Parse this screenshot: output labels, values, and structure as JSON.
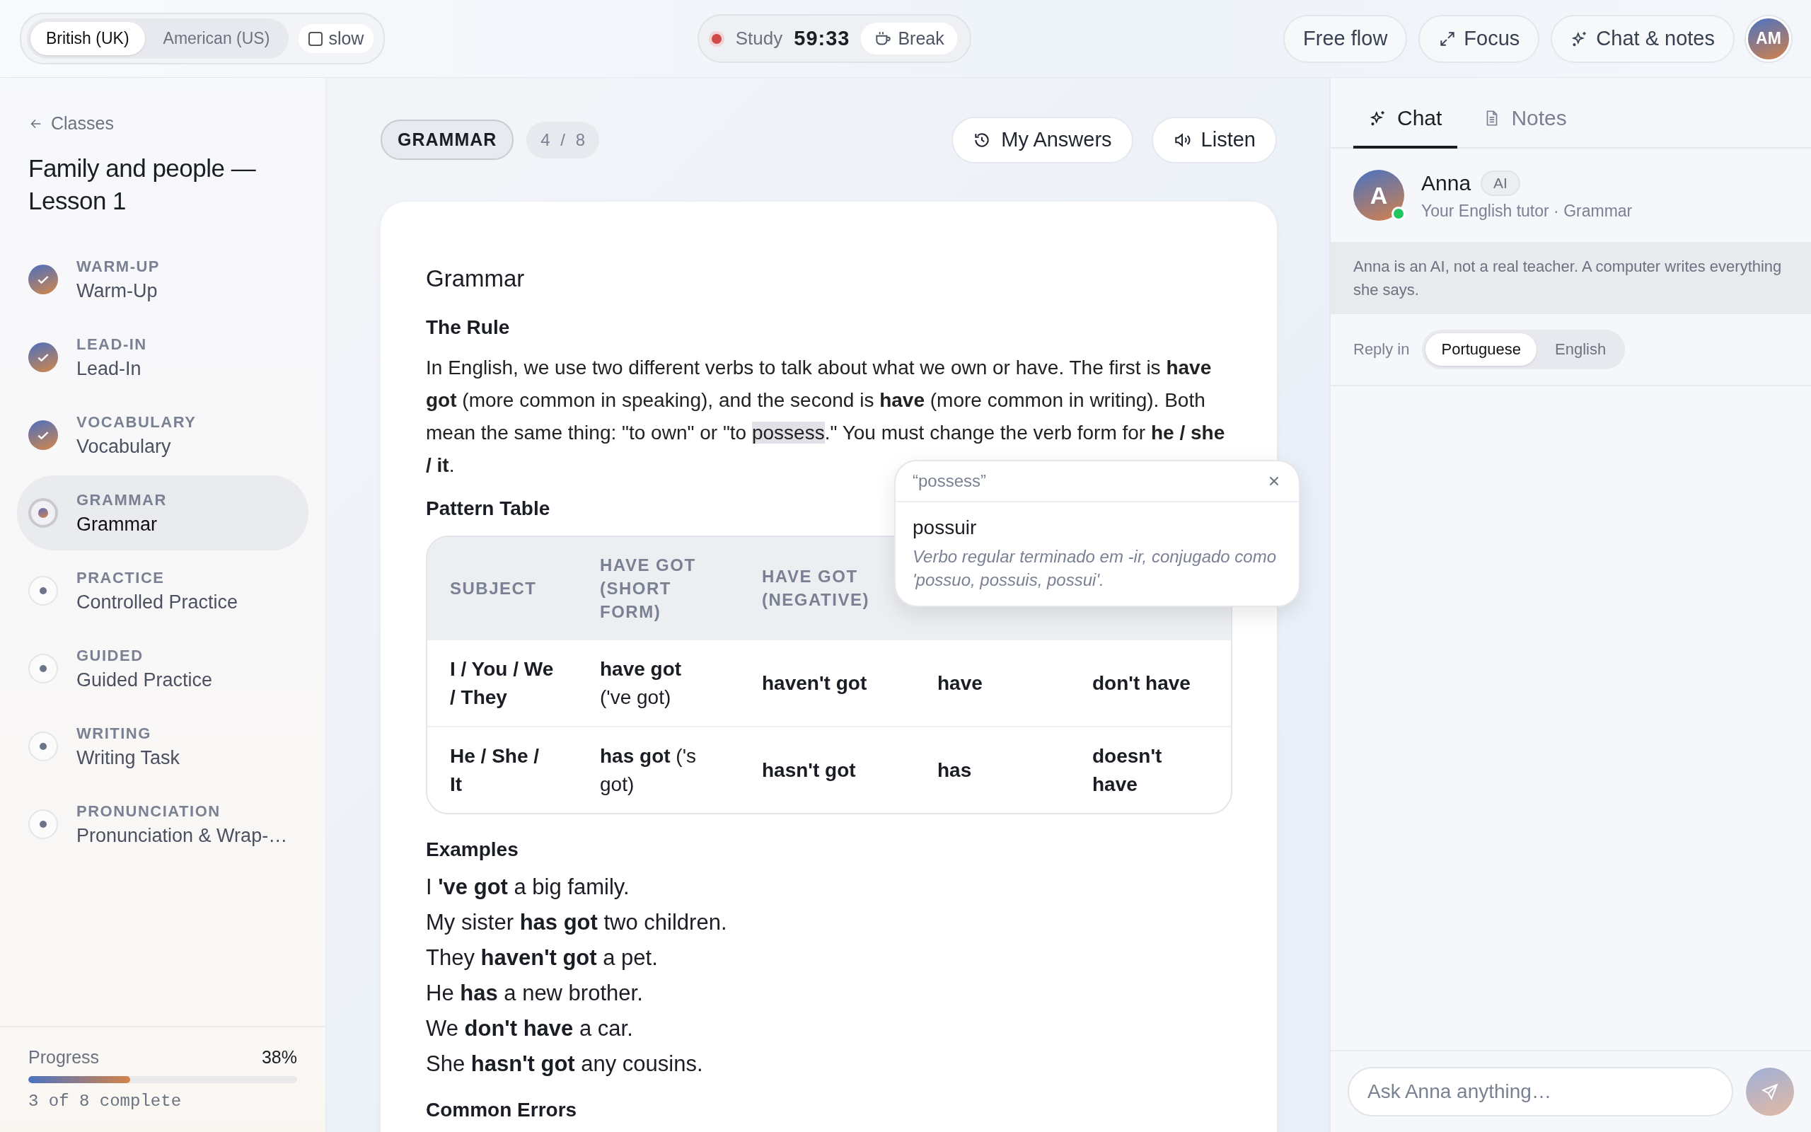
{
  "topbar": {
    "accents": [
      {
        "label": "British (UK)",
        "selected": true
      },
      {
        "label": "American (US)",
        "selected": false
      }
    ],
    "slow": {
      "label": "slow",
      "checked": false
    },
    "timer": {
      "label": "Study",
      "time": "59:33",
      "recording": true
    },
    "break_button": "Break",
    "actions": [
      {
        "label": "Free flow"
      },
      {
        "label": "Focus"
      },
      {
        "label": "Chat & notes"
      }
    ],
    "avatar": "AM"
  },
  "sidebar": {
    "back": "Classes",
    "title": "Family and people — Lesson 1",
    "steps": [
      {
        "category": "WARM-UP",
        "label": "Warm-Up",
        "done": true,
        "selected": false
      },
      {
        "category": "LEAD-IN",
        "label": "Lead-In",
        "done": true,
        "selected": false
      },
      {
        "category": "VOCABULARY",
        "label": "Vocabulary",
        "done": true,
        "selected": false
      },
      {
        "category": "GRAMMAR",
        "label": "Grammar",
        "done": false,
        "selected": true
      },
      {
        "category": "PRACTICE",
        "label": "Controlled Practice",
        "done": false,
        "selected": false
      },
      {
        "category": "GUIDED",
        "label": "Guided Practice",
        "done": false,
        "selected": false
      },
      {
        "category": "WRITING",
        "label": "Writing Task",
        "done": false,
        "selected": false
      },
      {
        "category": "PRONUNCIATION",
        "label": "Pronunciation & Wrap-…",
        "done": false,
        "selected": false
      }
    ],
    "progress": {
      "label": "Progress",
      "percent": "38%",
      "level": 0.38,
      "caption": "3 of 8 complete"
    }
  },
  "lesson": {
    "tag": "GRAMMAR",
    "counter": "4 / 8",
    "buttons": [
      "My Answers",
      "Listen"
    ],
    "title": "Grammar",
    "rule_heading": "The Rule",
    "rule": [
      {
        "text": "In English, we use two different verbs to talk about what we own or have. The first is **have got** (more common in speaking), and the second is **have** (more common in writing). Both mean the same thing: \"to own\" or \"to ",
        "highlighted": false
      },
      {
        "text": "possess",
        "highlighted": true
      },
      {
        "text": ".\" You must change the verb form for **he / she / it**.",
        "highlighted": false
      }
    ],
    "table_heading": "Pattern Table",
    "table": {
      "columns": [
        "SUBJECT",
        "HAVE GOT (SHORT FORM)",
        "HAVE GOT (NEGATIVE)"
      ],
      "rows": [
        [
          "I / You / We / They",
          "**have got** ('ve got)",
          "haven't got",
          "have",
          "don't have"
        ],
        [
          "He / She / It",
          "**has got** ('s got)",
          "hasn't got",
          "has",
          "doesn't have"
        ]
      ]
    },
    "popup": {
      "word": "“possess”",
      "translation": "possuir",
      "note": "Verbo regular terminado em -ir, conjugado como 'possuo, possuis, possui'."
    },
    "examples_heading": "Examples",
    "examples": [
      "I **'ve got** a big family.",
      "My sister **has got** two children.",
      "They **haven't got** a pet.",
      "He **has** a new brother.",
      "We **don't have** a car.",
      "She **hasn't got** any cousins."
    ],
    "errors_heading": "Common Errors"
  },
  "panel": {
    "tabs": [
      {
        "label": "Chat",
        "selected": true
      },
      {
        "label": "Notes",
        "selected": false
      }
    ],
    "tutor": {
      "initial": "A",
      "name": "Anna",
      "badge": "AI",
      "subtitle": "Your English tutor · Grammar",
      "online": true
    },
    "notice": "Anna is an AI, not a real teacher. A computer writes everything she says.",
    "reply": {
      "label": "Reply in",
      "options": [
        {
          "label": "Portuguese",
          "selected": true
        },
        {
          "label": "English",
          "selected": false
        }
      ]
    },
    "input": {
      "placeholder": "Ask Anna anything…"
    }
  }
}
